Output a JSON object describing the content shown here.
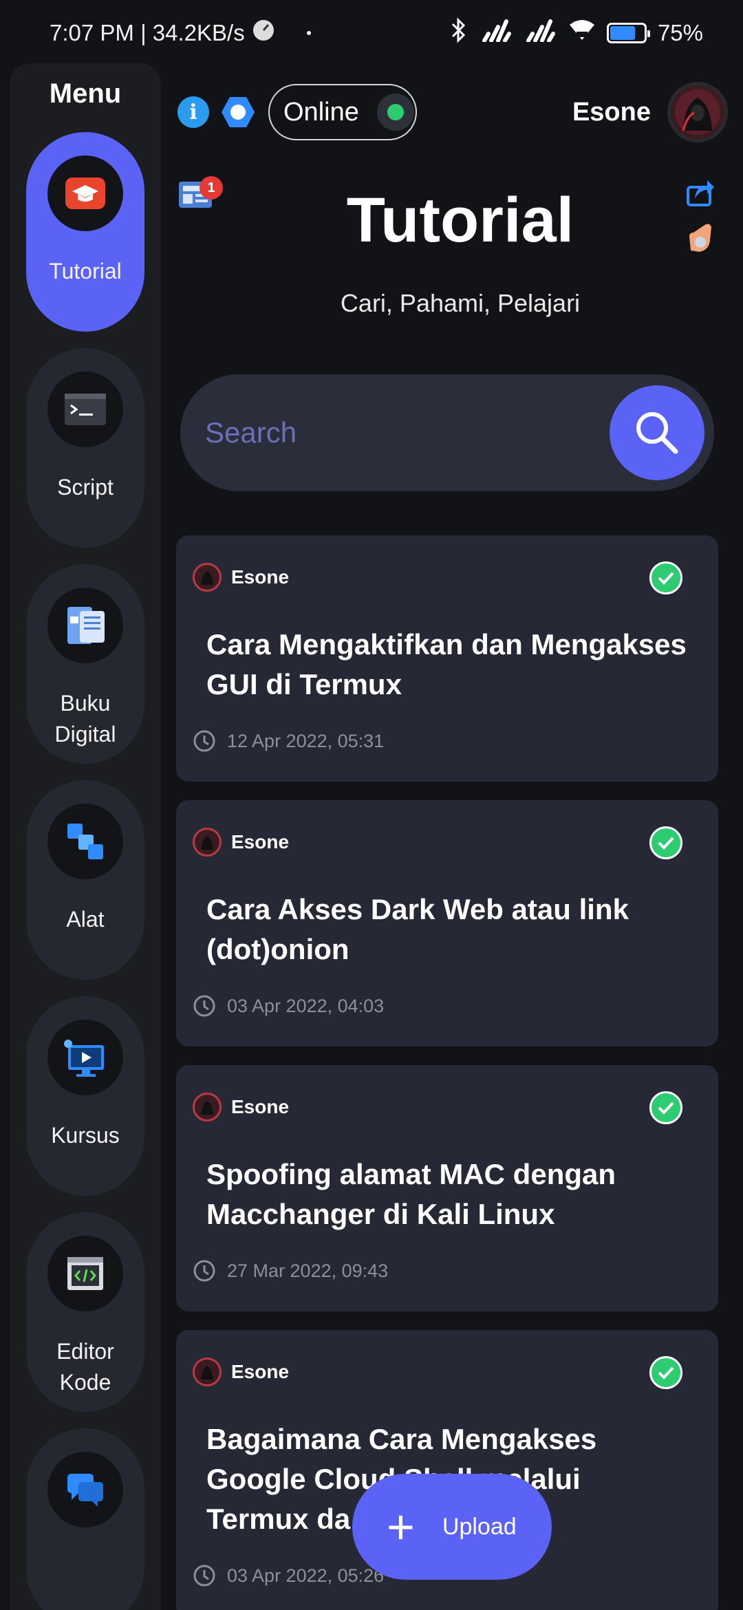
{
  "status_bar": {
    "time_speed": "7:07 PM | 34.2KB/s",
    "battery": "75%",
    "battery_level": 0.75
  },
  "sidebar": {
    "title": "Menu",
    "items": [
      {
        "label": "Tutorial",
        "icon": "graduation-cap-icon",
        "active": true
      },
      {
        "label": "Script",
        "icon": "terminal-icon",
        "active": false
      },
      {
        "label": "Buku Digital",
        "icon": "book-icon",
        "active": false
      },
      {
        "label": "Alat",
        "icon": "tools-blocks-icon",
        "active": false
      },
      {
        "label": "Kursus",
        "icon": "course-monitor-icon",
        "active": false
      },
      {
        "label": "Editor Kode",
        "icon": "code-editor-icon",
        "active": false
      },
      {
        "label": "",
        "icon": "chat-bubbles-icon",
        "active": false
      }
    ]
  },
  "header": {
    "status": "Online",
    "username": "Esone",
    "notification_count": "1"
  },
  "page": {
    "title": "Tutorial",
    "subtitle": "Cari, Pahami, Pelajari"
  },
  "search": {
    "placeholder": "Search"
  },
  "posts": [
    {
      "author": "Esone",
      "title": "Cara Mengaktifkan dan Mengakses GUI di Termux",
      "date": "12 Apr 2022, 05:31"
    },
    {
      "author": "Esone",
      "title": "Cara Akses Dark Web atau link (dot)onion",
      "date": "03 Apr 2022, 04:03"
    },
    {
      "author": "Esone",
      "title": "Spoofing alamat MAC dengan Macchanger di Kali Linux",
      "date": "27 Mar 2022, 09:43"
    },
    {
      "author": "Esone",
      "title": "Bagaimana Cara Mengakses Google Cloud Shell melalui Termux da",
      "date": "03 Apr 2022, 05:26"
    }
  ],
  "fab": {
    "label": "Upload"
  },
  "colors": {
    "accent": "#5a63f5",
    "online": "#2ecc71",
    "card": "#262935",
    "background": "#121316"
  }
}
